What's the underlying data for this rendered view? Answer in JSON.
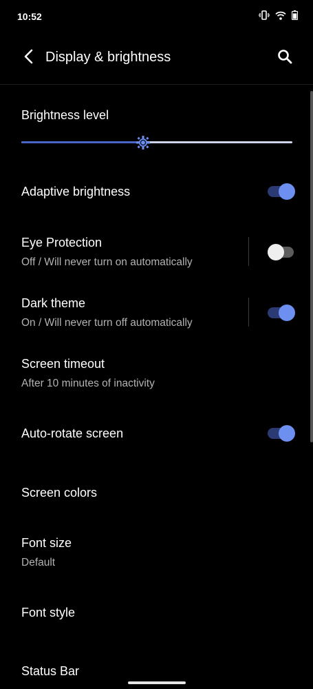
{
  "status_bar": {
    "time": "10:52",
    "icons": [
      "vibrate-icon",
      "wifi-icon",
      "battery-icon"
    ]
  },
  "header": {
    "title": "Display & brightness",
    "back_icon": "back-arrow-icon",
    "search_icon": "search-icon"
  },
  "brightness": {
    "title": "Brightness level",
    "level": 0.45
  },
  "settings": [
    {
      "title": "Adaptive brightness",
      "toggle": "on"
    },
    {
      "title": "Eye Protection",
      "subtitle": "Off / Will never turn on automatically",
      "toggle": "off"
    },
    {
      "title": "Dark theme",
      "subtitle": "On / Will never turn off automatically",
      "toggle": "on"
    },
    {
      "title": "Screen timeout",
      "subtitle": "After 10 minutes of inactivity"
    },
    {
      "title": "Auto-rotate screen",
      "toggle": "on"
    },
    {
      "title": "Screen colors"
    },
    {
      "title": "Font size",
      "subtitle": "Default"
    },
    {
      "title": "Font style"
    },
    {
      "title": "Status Bar"
    }
  ],
  "colors": {
    "accent": "#6c8ff0",
    "track_on": "#2c3a73",
    "background": "#000000"
  }
}
